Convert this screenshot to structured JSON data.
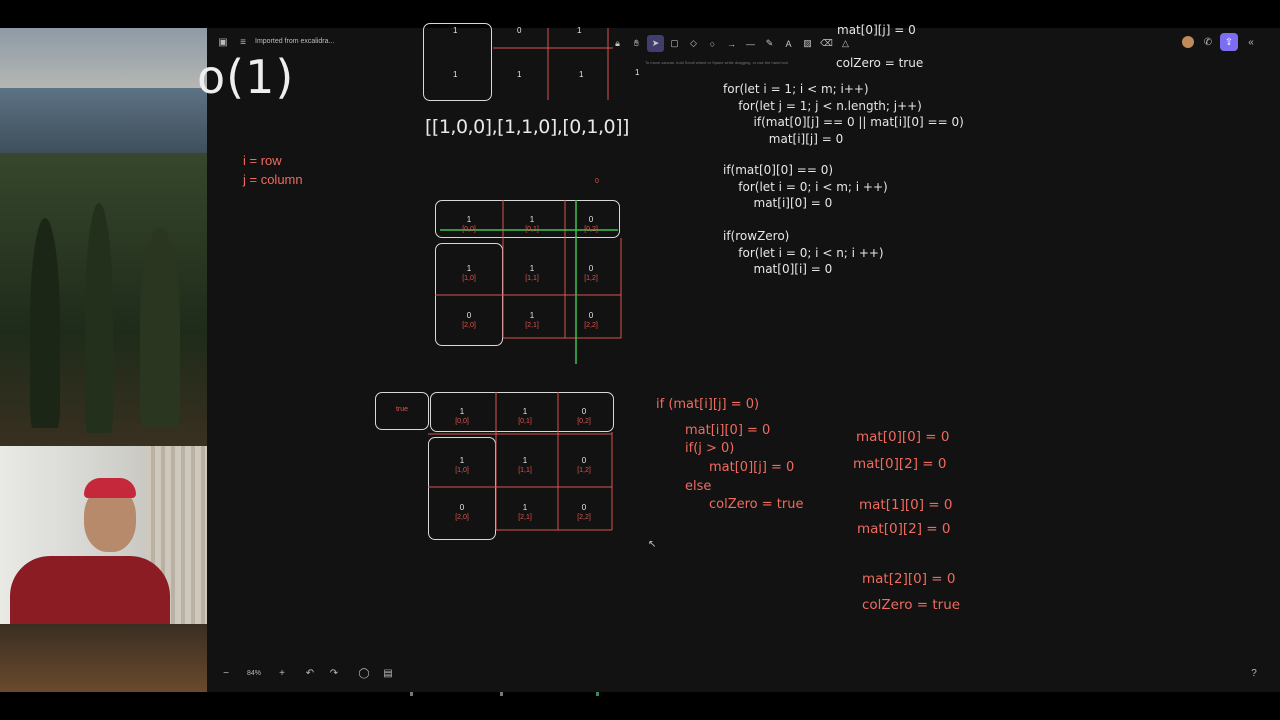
{
  "app": {
    "import_label": "Imported from excalidra...",
    "zoom": "84%",
    "tool_hint": "To move canvas, hold Scroll wheel or Space while dragging, or use the hand tool"
  },
  "toolbar": {
    "tools": [
      "lock-icon",
      "hand-icon",
      "selection-icon",
      "rectangle-icon",
      "diamond-icon",
      "ellipse-icon",
      "arrow-icon",
      "line-icon",
      "pencil-icon",
      "text-icon",
      "image-icon",
      "eraser-icon",
      "more-tools-icon"
    ],
    "active": "selection-icon"
  },
  "big_text": "o(1)",
  "legend": {
    "line1": "i = row",
    "line2": "j = column"
  },
  "top_matrix": {
    "row0": [
      "1",
      "0",
      "1"
    ],
    "row1": [
      "1",
      "1",
      "1"
    ],
    "extra": "1",
    "literal": "[[1,0,0],[1,1,0],[0,1,0]]"
  },
  "mid_matrix": {
    "marker": "0",
    "cells": [
      [
        {
          "v": "1",
          "p": "[0,0]"
        },
        {
          "v": "1",
          "p": "[0,1]"
        },
        {
          "v": "0",
          "p": "[0,2]"
        }
      ],
      [
        {
          "v": "1",
          "p": "[1,0]"
        },
        {
          "v": "1",
          "p": "[1,1]"
        },
        {
          "v": "0",
          "p": "[1,2]"
        }
      ],
      [
        {
          "v": "0",
          "p": "[2,0]"
        },
        {
          "v": "1",
          "p": "[2,1]"
        },
        {
          "v": "0",
          "p": "[2,2]"
        }
      ]
    ]
  },
  "bot_matrix": {
    "flag": "true",
    "cells": [
      [
        {
          "v": "1",
          "p": "[0,0]"
        },
        {
          "v": "1",
          "p": "[0,1]"
        },
        {
          "v": "0",
          "p": "[0,2]"
        }
      ],
      [
        {
          "v": "1",
          "p": "[1,0]"
        },
        {
          "v": "1",
          "p": "[1,1]"
        },
        {
          "v": "0",
          "p": "[1,2]"
        }
      ],
      [
        {
          "v": "0",
          "p": "[2,0]"
        },
        {
          "v": "1",
          "p": "[2,1]"
        },
        {
          "v": "0",
          "p": "[2,2]"
        }
      ]
    ]
  },
  "code_white": {
    "top_partial": "mat[0][j] = 0",
    "colzero_line": "colZero = true",
    "block1": [
      "for(let i = 1; i < m; i++)",
      "    for(let j = 1; j < n.length; j++)",
      "        if(mat[0][j] == 0 || mat[i][0] == 0)",
      "            mat[i][j] = 0"
    ],
    "block2": [
      "if(mat[0][0] == 0)",
      "    for(let i = 0; i < m; i ++)",
      "        mat[i][0] = 0"
    ],
    "block3": [
      "if(rowZero)",
      "    for(let i = 0; i < n; i ++)",
      "        mat[0][i] = 0"
    ]
  },
  "code_red": {
    "l1": "if (mat[i][j] = 0)",
    "l2": "mat[i][0] = 0",
    "l3": "if(j > 0)",
    "l4": "mat[0][j] = 0",
    "l5": "else",
    "l6": "colZero = true"
  },
  "notes_red": [
    "mat[0][0] = 0",
    "mat[0][2] = 0",
    "mat[1][0] = 0",
    "mat[0][2] = 0",
    "mat[2][0] = 0",
    "colZero = true"
  ]
}
